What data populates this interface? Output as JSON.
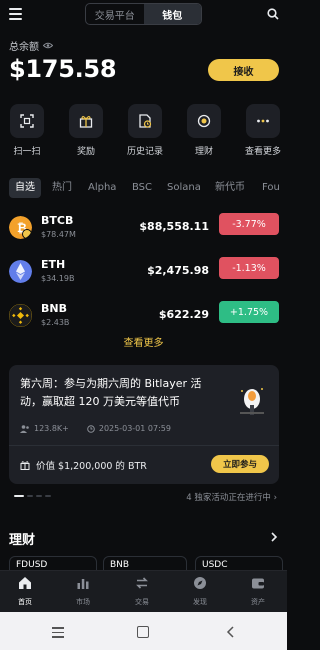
{
  "header": {
    "tabs": [
      "交易平台",
      "钱包"
    ],
    "active_tab": "钱包"
  },
  "balance": {
    "label": "总余额",
    "value": "$175.58",
    "receive_label": "接收"
  },
  "quick_actions": [
    {
      "label": "扫一扫",
      "icon": "scan-icon"
    },
    {
      "label": "奖励",
      "icon": "gift-icon"
    },
    {
      "label": "历史记录",
      "icon": "history-icon"
    },
    {
      "label": "理财",
      "icon": "earn-icon"
    },
    {
      "label": "查看更多",
      "icon": "more-icon"
    }
  ],
  "market_tabs": [
    "自选",
    "热门",
    "Alpha",
    "BSC",
    "Solana",
    "新代币",
    "Fou"
  ],
  "coins": [
    {
      "symbol": "BTCB",
      "cap": "$78.47M",
      "price": "$88,558.11",
      "change": "-3.77%",
      "color": "#e05260"
    },
    {
      "symbol": "ETH",
      "cap": "$34.19B",
      "price": "$2,475.98",
      "change": "-1.13%",
      "color": "#e05260"
    },
    {
      "symbol": "BNB",
      "cap": "$2.43B",
      "price": "$622.29",
      "change": "+1.75%",
      "color": "#2ebd85"
    }
  ],
  "see_more": "查看更多",
  "promo": {
    "title": "第六周：参与为期六周的 Bitlayer 活动，赢取超 120 万美元等值代币",
    "participants": "123.8K+",
    "date": "2025-03-01 07:59",
    "prize": "价值 $1,200,000 的 BTR",
    "join_label": "立即参与"
  },
  "ongoing_text": "4 独家活动正在进行中",
  "earn_section": {
    "title": "理财",
    "chips": [
      "FDUSD",
      "BNB",
      "USDC"
    ]
  },
  "bottom_nav": [
    "首页",
    "市场",
    "交易",
    "发现",
    "资产"
  ],
  "colors": {
    "accent": "#f0c64a",
    "down": "#e05260",
    "up": "#2ebd85"
  }
}
